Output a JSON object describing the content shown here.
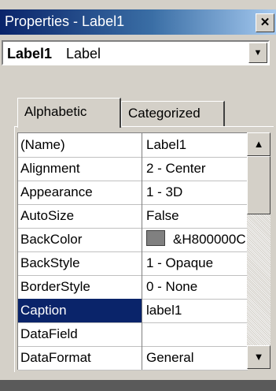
{
  "window": {
    "title": "Properties - Label1"
  },
  "object_selector": {
    "name": "Label1",
    "type": "Label"
  },
  "tabs": [
    {
      "label": "Alphabetic"
    },
    {
      "label": "Categorized"
    }
  ],
  "properties": [
    {
      "name": "(Name)",
      "value": "Label1"
    },
    {
      "name": "Alignment",
      "value": "2 - Center"
    },
    {
      "name": "Appearance",
      "value": "1 - 3D"
    },
    {
      "name": "AutoSize",
      "value": "False"
    },
    {
      "name": "BackColor",
      "value": "&H800000C",
      "swatch": "#808080"
    },
    {
      "name": "BackStyle",
      "value": "1 - Opaque"
    },
    {
      "name": "BorderStyle",
      "value": "0 - None"
    },
    {
      "name": "Caption",
      "value": "label1",
      "selected": true
    },
    {
      "name": "DataField",
      "value": ""
    },
    {
      "name": "DataFormat",
      "value": "General"
    }
  ],
  "colors": {
    "selection": "#0a246a",
    "title_bar": "#0a246a",
    "face": "#d4d0c8"
  }
}
